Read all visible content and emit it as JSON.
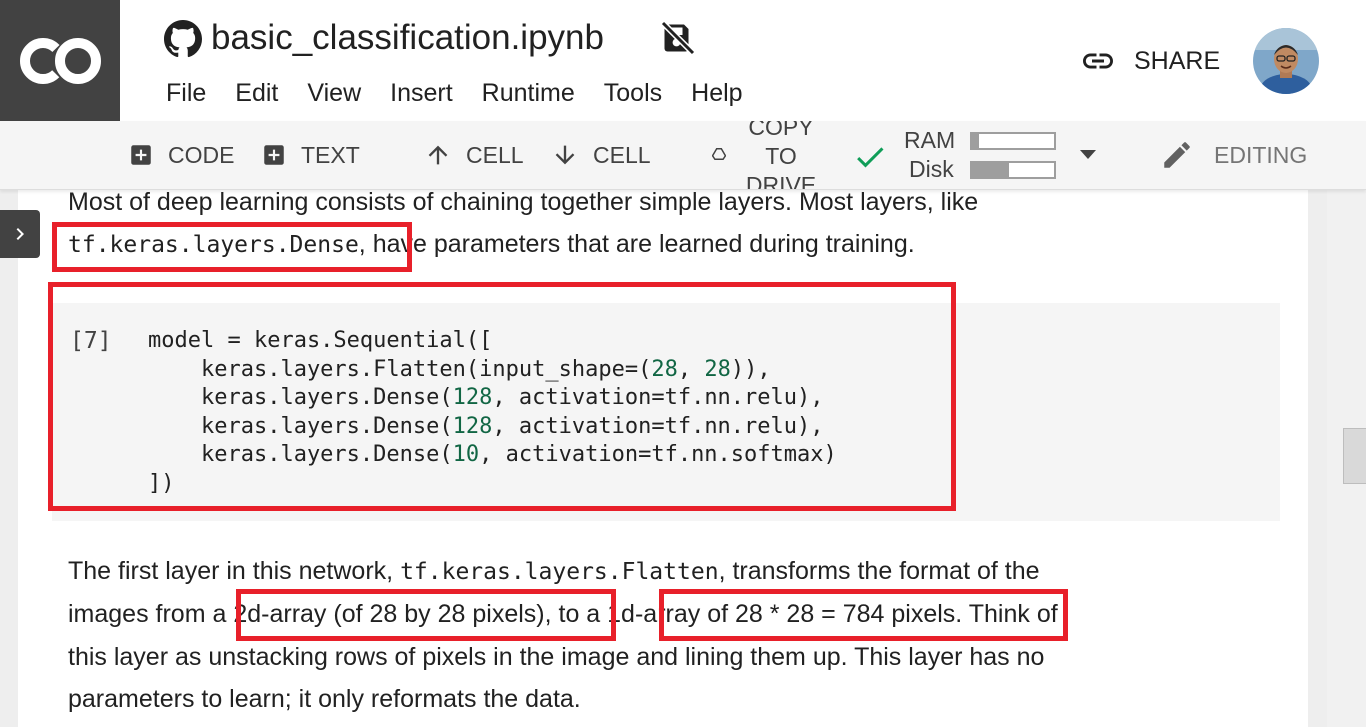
{
  "header": {
    "doc_title": "basic_classification.ipynb",
    "logo_text": "CO",
    "share_label": "SHARE",
    "menu": [
      "File",
      "Edit",
      "View",
      "Insert",
      "Runtime",
      "Tools",
      "Help"
    ]
  },
  "toolbar": {
    "add_code": "CODE",
    "add_text": "TEXT",
    "cell_up": "CELL",
    "cell_down": "CELL",
    "copy_to_drive": "COPY TO DRIVE",
    "ram_label": "RAM",
    "disk_label": "Disk",
    "ram_usage": 0.08,
    "disk_usage": 0.45,
    "editing_label": "EDITING"
  },
  "notebook": {
    "para1_line1": "Most of deep learning consists of chaining together simple layers. Most layers, like",
    "para1_code": "tf.keras.layers.Dense",
    "para1_line2_rest": ", have parameters that are learned during training.",
    "code_cell": {
      "exec_count": "[7]",
      "lines": [
        "model = keras.Sequential([",
        "    keras.layers.Flatten(input_shape=(28, 28)),",
        "    keras.layers.Dense(128, activation=tf.nn.relu),",
        "    keras.layers.Dense(128, activation=tf.nn.relu),",
        "    keras.layers.Dense(10, activation=tf.nn.softmax)",
        "])"
      ]
    },
    "para2_line1_a": "The first layer in this network, ",
    "para2_code": "tf.keras.layers.Flatten",
    "para2_line1_b": ", transforms the format of the",
    "para2_line2_a": "images from a ",
    "para2_line2_hl1": "2d-array (of 28 by 28 pixels)",
    "para2_line2_b": ", to a ",
    "para2_line2_hl2": "1d-array of 28 * 28 = 784 pixels",
    "para2_line2_c": ". Think of",
    "para2_line3": "this layer as unstacking rows of pixels in the image and lining them up. This layer has no",
    "para2_line4": "parameters to learn; it only reformats the data."
  },
  "colors": {
    "highlight": "#e8202a",
    "logo_bg": "#424242",
    "check": "#0f9d58",
    "number_literal": "#116644"
  }
}
